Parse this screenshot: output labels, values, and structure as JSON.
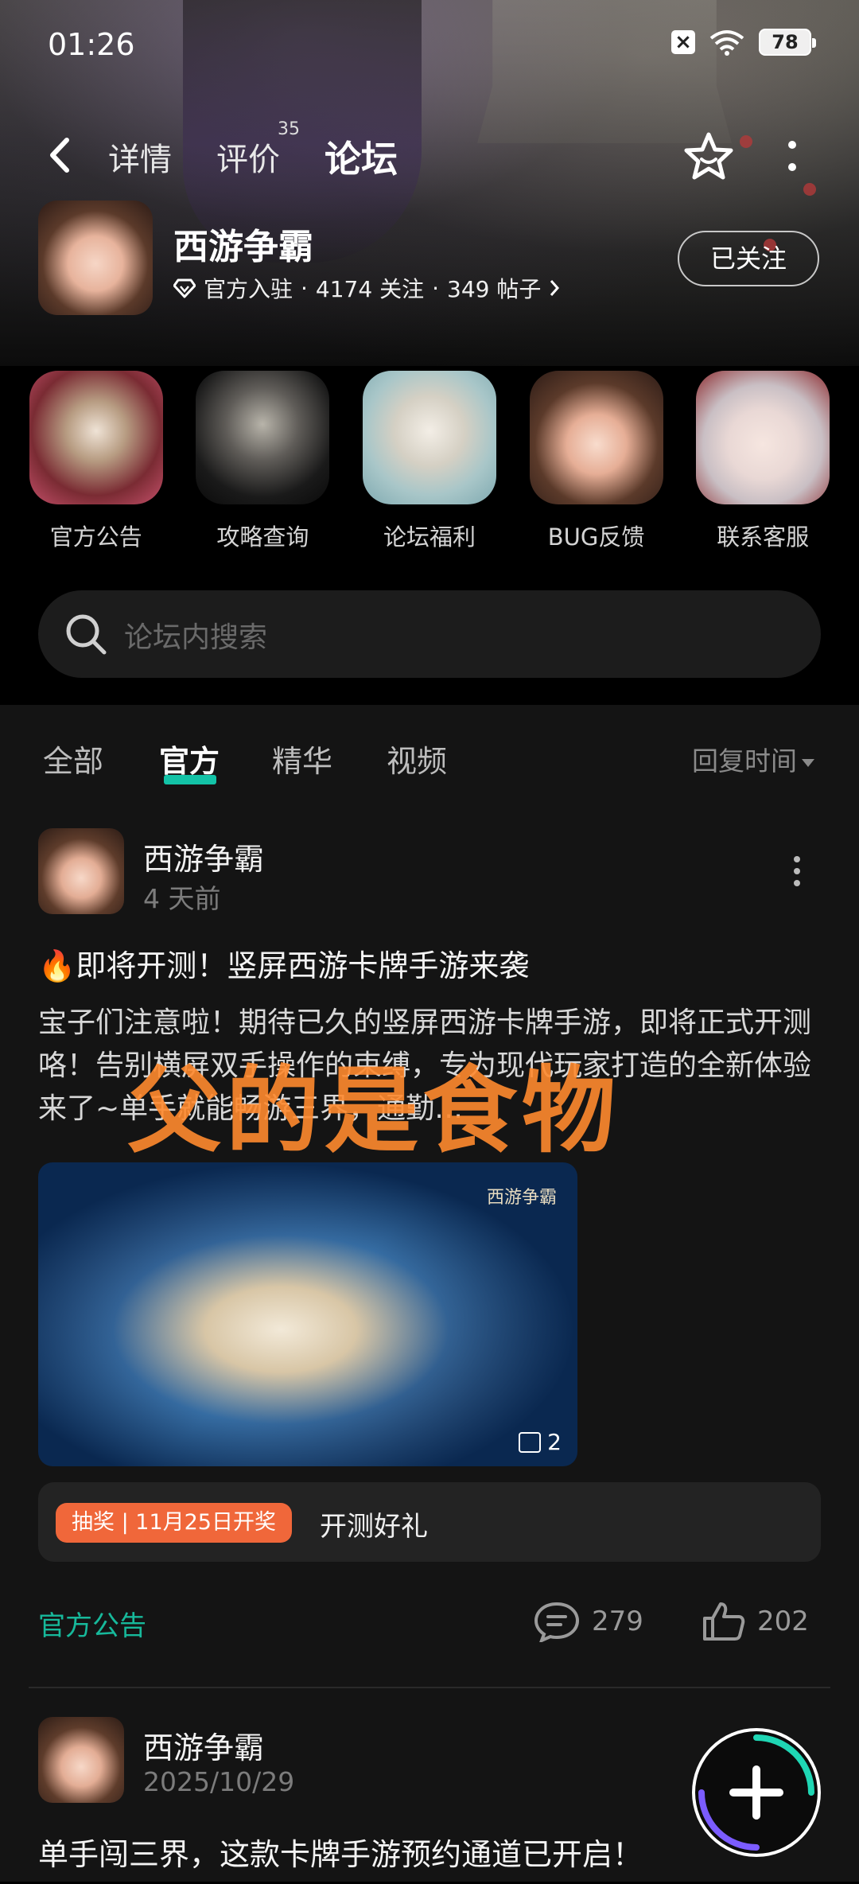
{
  "status_bar": {
    "time": "01:26",
    "battery": "78"
  },
  "nav": {
    "tabs": [
      {
        "label": "详情"
      },
      {
        "label": "评价",
        "badge": "35"
      },
      {
        "label": "论坛"
      }
    ]
  },
  "game": {
    "name": "西游争霸",
    "verified": "官方入驻",
    "followers": "4174 关注",
    "posts": "349 帖子",
    "follow_label": "已关注"
  },
  "shortcuts": [
    {
      "label": "官方公告"
    },
    {
      "label": "攻略查询"
    },
    {
      "label": "论坛福利"
    },
    {
      "label": "BUG反馈"
    },
    {
      "label": "联系客服"
    }
  ],
  "search": {
    "placeholder": "论坛内搜索"
  },
  "filter": {
    "tabs": [
      "全部",
      "官方",
      "精华",
      "视频"
    ],
    "sort_label": "回复时间"
  },
  "posts": [
    {
      "author": "西游争霸",
      "time": "4 天前",
      "title": "🔥即将开测！竖屏西游卡牌手游来袭",
      "body": "宝子们注意啦！期待已久的竖屏西游卡牌手游，即将正式开测咯！告别横屏双手操作的束缚，专为现代玩家打造的全新体验来了~单手就能畅游三界，通勤…",
      "image_count": "2",
      "image_watermark": "西游争霸",
      "lottery_badge": "抽奖 | 11月25日开奖",
      "lottery_text": "开测好礼",
      "category": "官方公告",
      "comments": "279",
      "likes": "202"
    },
    {
      "author": "西游争霸",
      "time": "2025/10/29",
      "title": "单手闯三界，这款卡牌手游预约通道已开启！"
    }
  ],
  "overlay_text": "父的是食物",
  "colors": {
    "accent": "#13c3a7",
    "badge": "#f0673a",
    "watermark": "#ff8a2e"
  }
}
